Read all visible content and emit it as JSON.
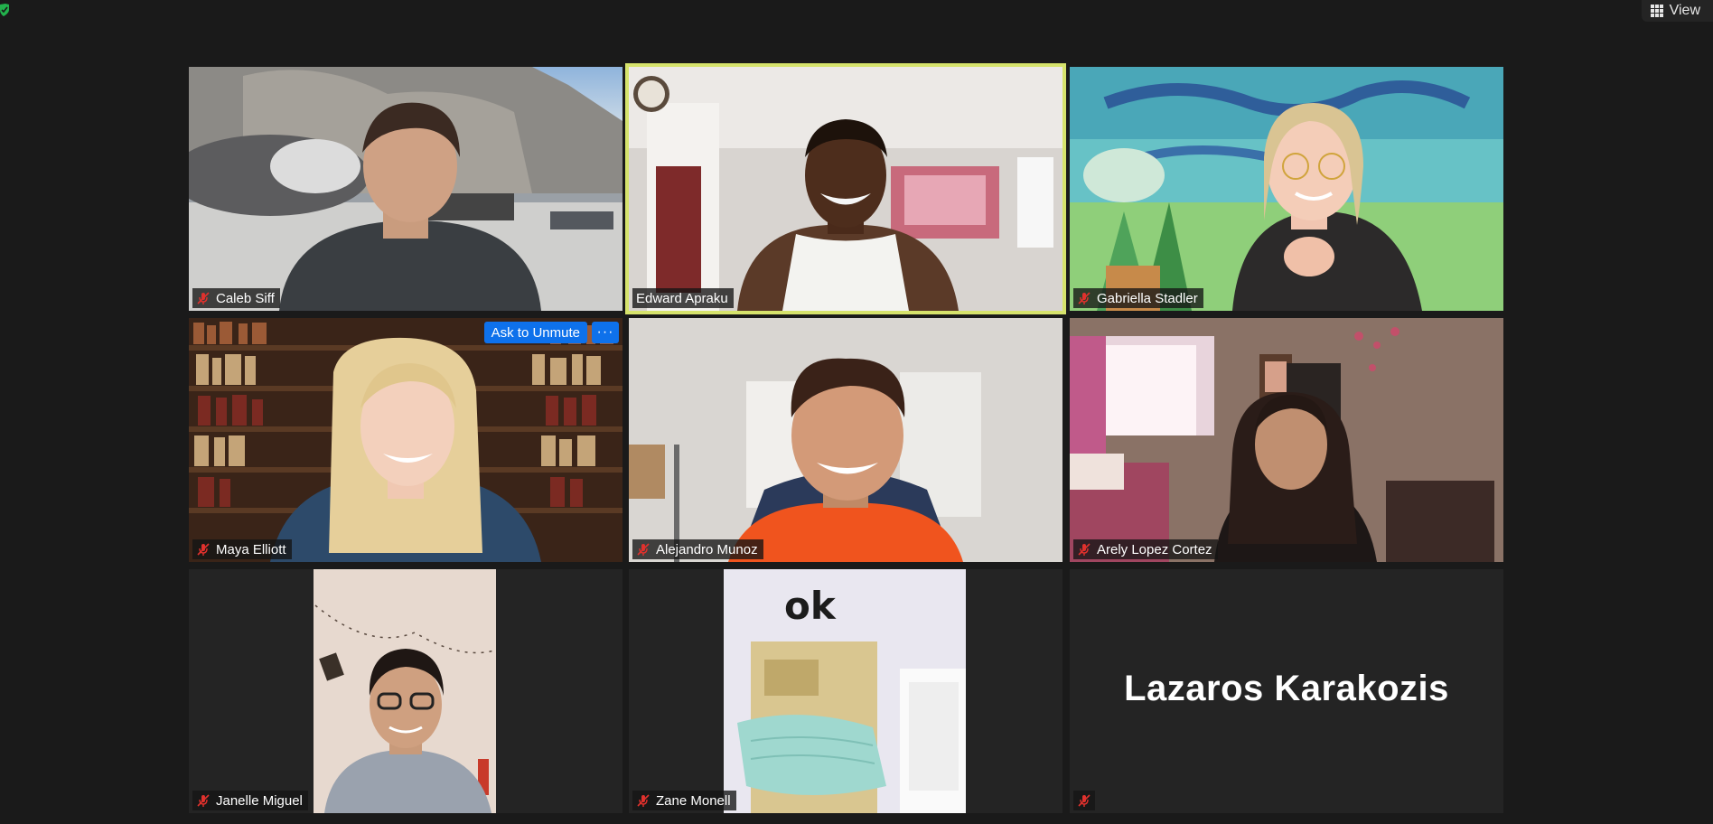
{
  "top_bar": {
    "view_label": "View",
    "security_icon": "shield-check-icon",
    "view_icon": "grid-icon"
  },
  "colors": {
    "background": "#1a1a1a",
    "tile_background": "#242424",
    "active_speaker": "#d6e36c",
    "unmute_button": "#0e71eb",
    "mute_icon": "#e0312d"
  },
  "participants": [
    {
      "name": "Caleb Siff",
      "muted": true,
      "video": "person-starwars-background"
    },
    {
      "name": "Edward Apraku",
      "muted": false,
      "active_speaker": true,
      "video": "person-bedroom"
    },
    {
      "name": "Gabriella Stadler",
      "muted": true,
      "video": "person-anime-background"
    },
    {
      "name": "Maya Elliott",
      "muted": true,
      "video": "person-bookshelf-background",
      "hover": {
        "ask_to_unmute": "Ask to Unmute",
        "more": "···"
      }
    },
    {
      "name": "Alejandro Munoz",
      "muted": true,
      "video": "person-gaming-chair"
    },
    {
      "name": "Arely Lopez Cortez",
      "muted": true,
      "video": "person-bedroom-window"
    },
    {
      "name": "Janelle Miguel",
      "muted": true,
      "video": "person-portrait-camera"
    },
    {
      "name": "Zane Monell",
      "muted": true,
      "video": "ok-mask-image",
      "image_text": "ok"
    },
    {
      "name": "",
      "muted": true,
      "video": "none",
      "display_name": "Lazaros Karakozis"
    }
  ]
}
